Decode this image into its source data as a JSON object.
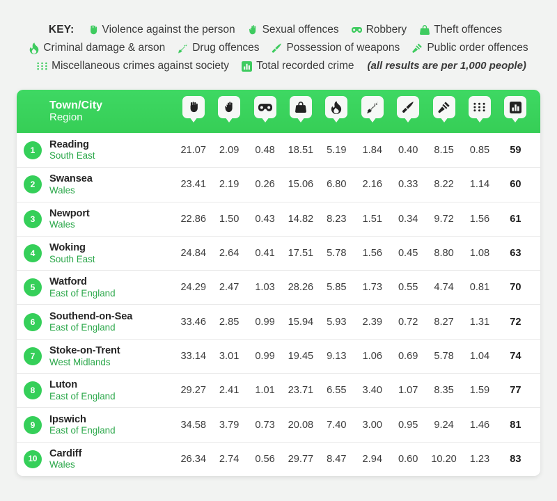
{
  "key": {
    "label": "KEY:",
    "items": [
      {
        "icon": "fist-icon",
        "label": "Violence against the person"
      },
      {
        "icon": "open-hand-icon",
        "label": "Sexual offences"
      },
      {
        "icon": "robber-mask-icon",
        "label": "Robbery"
      },
      {
        "icon": "handbag-icon",
        "label": "Theft offences"
      },
      {
        "icon": "flame-icon",
        "label": "Criminal damage & arson"
      },
      {
        "icon": "syringe-icon",
        "label": "Drug offences"
      },
      {
        "icon": "knife-icon",
        "label": "Possession of weapons"
      },
      {
        "icon": "gavel-icon",
        "label": "Public order offences"
      },
      {
        "icon": "dots-grid-icon",
        "label": "Miscellaneous crimes against society"
      },
      {
        "icon": "bar-chart-icon",
        "label": "Total recorded crime"
      }
    ],
    "note": "(all results are per 1,000 people)"
  },
  "colors": {
    "brand_green": "#3ad15a",
    "rank_green": "#35cf59",
    "region_green": "#2aa749",
    "page_bg": "#f2f3f2",
    "card_bg": "#ffffff"
  },
  "table": {
    "header": {
      "name_line1": "Town/City",
      "name_line2": "Region",
      "columns": [
        {
          "icon": "fist-icon",
          "title": "Violence against the person"
        },
        {
          "icon": "open-hand-icon",
          "title": "Sexual offences"
        },
        {
          "icon": "robber-mask-icon",
          "title": "Robbery"
        },
        {
          "icon": "handbag-icon",
          "title": "Theft offences"
        },
        {
          "icon": "flame-icon",
          "title": "Criminal damage & arson"
        },
        {
          "icon": "syringe-icon",
          "title": "Drug offences"
        },
        {
          "icon": "knife-icon",
          "title": "Possession of weapons"
        },
        {
          "icon": "gavel-icon",
          "title": "Public order offences"
        },
        {
          "icon": "dots-grid-icon",
          "title": "Miscellaneous crimes against society"
        },
        {
          "icon": "bar-chart-icon",
          "title": "Total recorded crime"
        }
      ]
    },
    "rows": [
      {
        "rank": "1",
        "town": "Reading",
        "region": "South East",
        "values": [
          "21.07",
          "2.09",
          "0.48",
          "18.51",
          "5.19",
          "1.84",
          "0.40",
          "8.15",
          "0.85",
          "59"
        ]
      },
      {
        "rank": "2",
        "town": "Swansea",
        "region": "Wales",
        "values": [
          "23.41",
          "2.19",
          "0.26",
          "15.06",
          "6.80",
          "2.16",
          "0.33",
          "8.22",
          "1.14",
          "60"
        ]
      },
      {
        "rank": "3",
        "town": "Newport",
        "region": "Wales",
        "values": [
          "22.86",
          "1.50",
          "0.43",
          "14.82",
          "8.23",
          "1.51",
          "0.34",
          "9.72",
          "1.56",
          "61"
        ]
      },
      {
        "rank": "4",
        "town": "Woking",
        "region": "South East",
        "values": [
          "24.84",
          "2.64",
          "0.41",
          "17.51",
          "5.78",
          "1.56",
          "0.45",
          "8.80",
          "1.08",
          "63"
        ]
      },
      {
        "rank": "5",
        "town": "Watford",
        "region": "East of England",
        "values": [
          "24.29",
          "2.47",
          "1.03",
          "28.26",
          "5.85",
          "1.73",
          "0.55",
          "4.74",
          "0.81",
          "70"
        ]
      },
      {
        "rank": "6",
        "town": "Southend-on-Sea",
        "region": "East of England",
        "values": [
          "33.46",
          "2.85",
          "0.99",
          "15.94",
          "5.93",
          "2.39",
          "0.72",
          "8.27",
          "1.31",
          "72"
        ]
      },
      {
        "rank": "7",
        "town": "Stoke-on-Trent",
        "region": "West Midlands",
        "values": [
          "33.14",
          "3.01",
          "0.99",
          "19.45",
          "9.13",
          "1.06",
          "0.69",
          "5.78",
          "1.04",
          "74"
        ]
      },
      {
        "rank": "8",
        "town": "Luton",
        "region": "East of England",
        "values": [
          "29.27",
          "2.41",
          "1.01",
          "23.71",
          "6.55",
          "3.40",
          "1.07",
          "8.35",
          "1.59",
          "77"
        ]
      },
      {
        "rank": "9",
        "town": "Ipswich",
        "region": "East of England",
        "values": [
          "34.58",
          "3.79",
          "0.73",
          "20.08",
          "7.40",
          "3.00",
          "0.95",
          "9.24",
          "1.46",
          "81"
        ]
      },
      {
        "rank": "10",
        "town": "Cardiff",
        "region": "Wales",
        "values": [
          "26.34",
          "2.74",
          "0.56",
          "29.77",
          "8.47",
          "2.94",
          "0.60",
          "10.20",
          "1.23",
          "83"
        ]
      }
    ]
  }
}
